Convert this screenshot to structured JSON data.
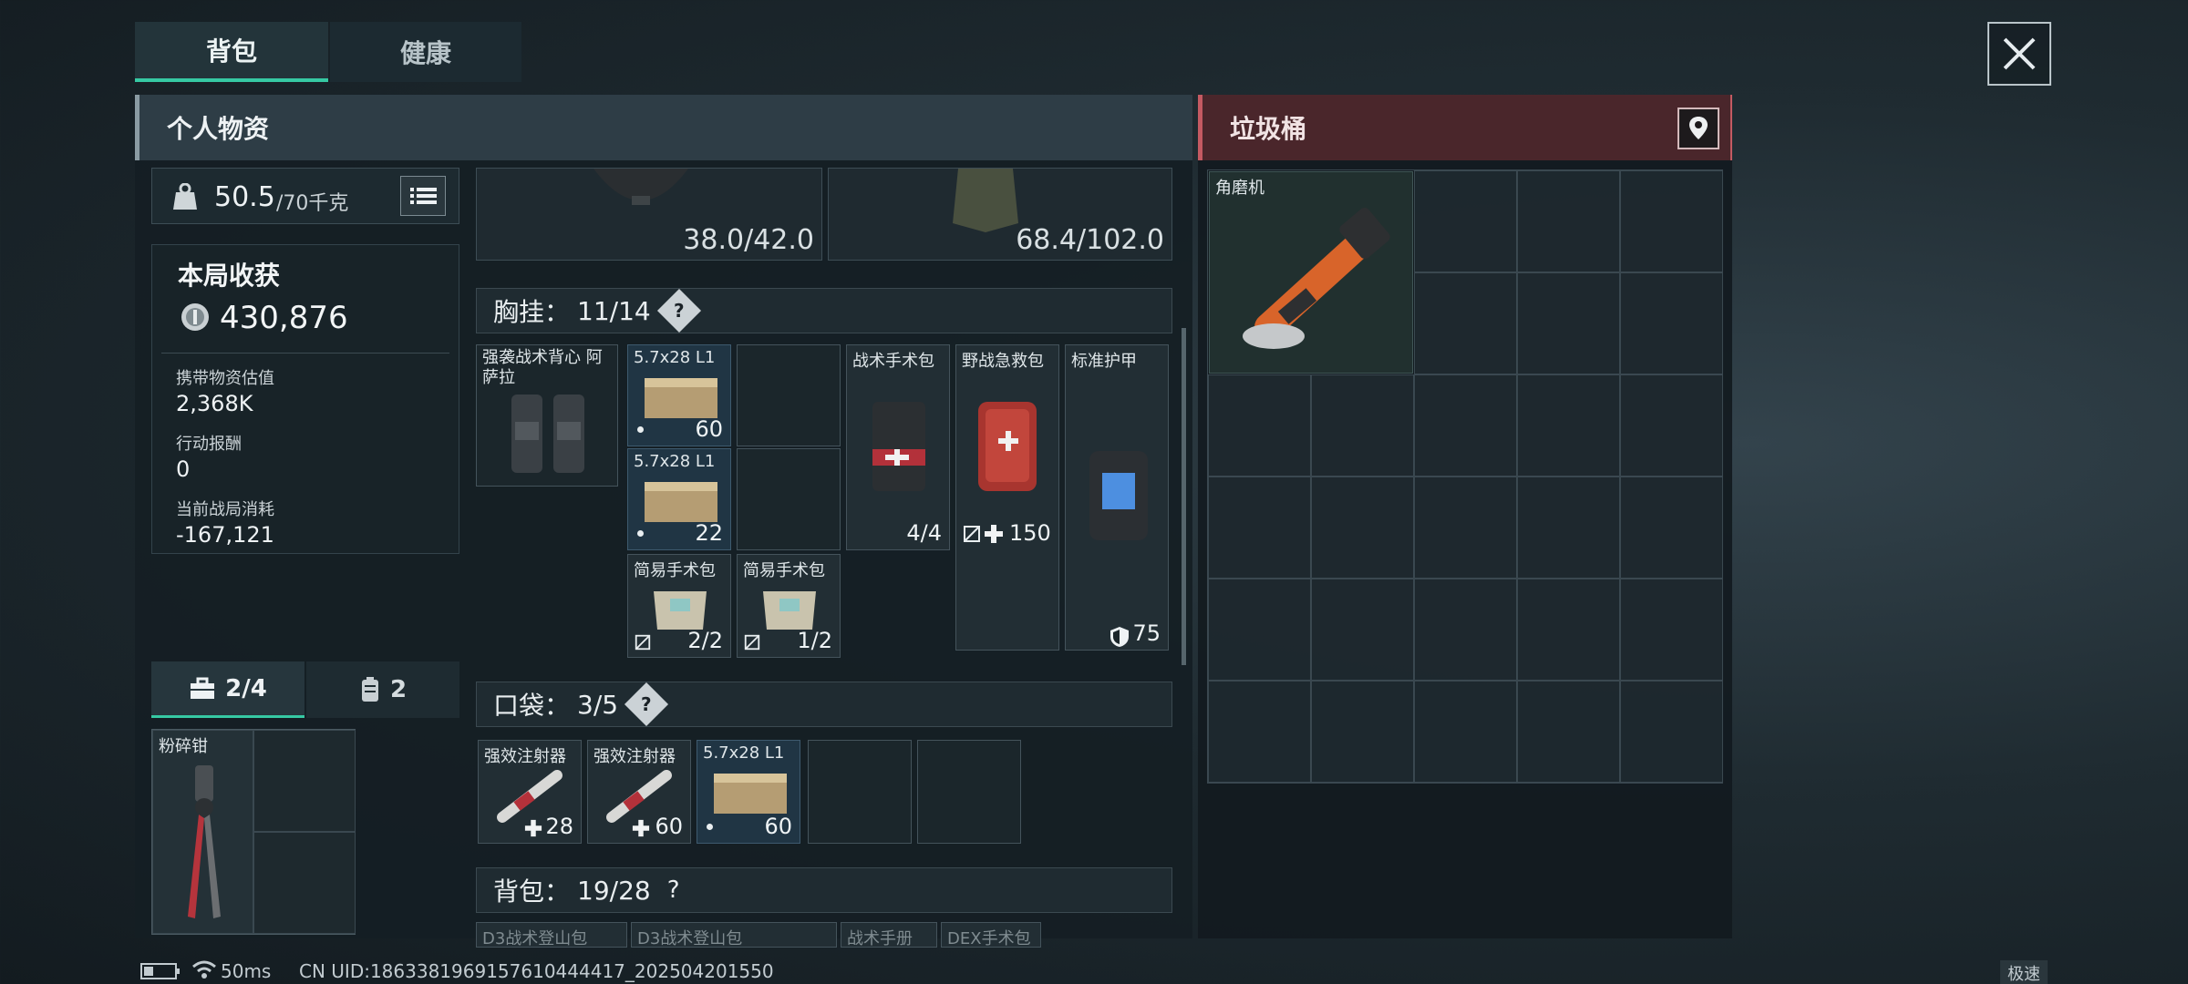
{
  "tabs": [
    {
      "label": "背包"
    },
    {
      "label": "健康"
    }
  ],
  "personal": {
    "title": "个人物资"
  },
  "trash": {
    "title": "垃圾桶",
    "item": "角磨机"
  },
  "weight": {
    "current": "50.5",
    "max": "/70千克"
  },
  "earnings": {
    "title": "本局收获",
    "value": "430,876",
    "stats": [
      {
        "label": "携带物资估值",
        "value": "2,368K"
      },
      {
        "label": "行动报酬",
        "value": "0"
      },
      {
        "label": "当前战局消耗",
        "value": "-167,121"
      }
    ]
  },
  "container_tabs": [
    {
      "label": "2/4"
    },
    {
      "label": "2"
    }
  ],
  "container_item": "粉碎钳",
  "durability": {
    "helmet": "38.0/42.0",
    "armor": "68.4/102.0"
  },
  "chest": {
    "label": "胸挂：",
    "count": "11/14",
    "help": "?",
    "items": [
      {
        "name": "强袭战术背心 阿萨拉"
      },
      {
        "name": "5.7x28 L1",
        "count": "60"
      },
      {
        "name": "5.7x28 L1",
        "count": "22"
      },
      {
        "name": "战术手术包",
        "count": "4/4"
      },
      {
        "name": "野战急救包",
        "count": "150"
      },
      {
        "name": "标准护甲",
        "count": "75"
      },
      {
        "name": "简易手术包",
        "count": "2/2"
      },
      {
        "name": "简易手术包",
        "count": "1/2"
      }
    ]
  },
  "pocket": {
    "label": "口袋：",
    "count": "3/5",
    "help": "?",
    "items": [
      {
        "name": "强效注射器",
        "count": "28"
      },
      {
        "name": "强效注射器",
        "count": "60"
      },
      {
        "name": "5.7x28 L1",
        "count": "60"
      }
    ]
  },
  "backpack": {
    "label": "背包：",
    "count": "19/28",
    "help": "?",
    "items": [
      "D3战术登山包",
      "D3战术登山包",
      "战术手册",
      "DEX手术包"
    ]
  },
  "status": {
    "ping": "50ms",
    "uid": "CN UID:1863381969157610444417_202504201550",
    "mode": "极速"
  },
  "icons": [
    "close-icon",
    "weight-icon",
    "list-icon",
    "coin-icon",
    "map-pin-icon",
    "backpack-icon",
    "vest-icon",
    "medical-cross-icon",
    "shield-icon",
    "no-repair-icon",
    "battery-icon",
    "wifi-icon"
  ],
  "colors": {
    "accent": "#36c9a3",
    "trash": "#c45a62"
  }
}
